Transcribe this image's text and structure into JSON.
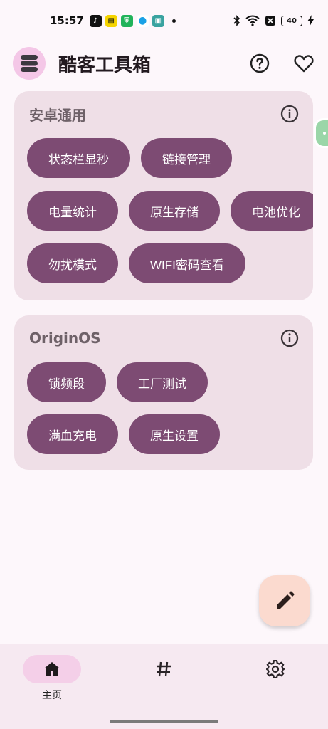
{
  "status_bar": {
    "time": "15:57",
    "battery": "40",
    "icons": [
      "tiktok-icon",
      "app-icon",
      "shield-app-icon",
      "qq-icon",
      "game-app-icon",
      "bluetooth-icon",
      "wifi-icon",
      "data-off-icon",
      "charging-icon"
    ]
  },
  "app": {
    "title": "酷客工具箱",
    "actions": [
      "help-icon",
      "favorite-icon"
    ]
  },
  "cards": [
    {
      "title": "安卓通用",
      "rows": [
        [
          "状态栏显秒",
          "链接管理"
        ],
        [
          "电量统计",
          "原生存储",
          "电池优化"
        ],
        [
          "勿扰模式",
          "WIFI密码查看"
        ]
      ]
    },
    {
      "title": "OriginOS",
      "rows": [
        [
          "锁频段",
          "工厂测试"
        ],
        [
          "满血充电",
          "原生设置"
        ]
      ]
    }
  ],
  "fab": {
    "icon": "edit-icon"
  },
  "bottom_nav": {
    "items": [
      {
        "label": "主页",
        "icon": "home-icon",
        "active": true
      },
      {
        "label": "",
        "icon": "hash-icon",
        "active": false
      },
      {
        "label": "",
        "icon": "settings-icon",
        "active": false
      }
    ]
  },
  "colors": {
    "chip": "#7d4b73",
    "card": "#efdfe7",
    "fab": "#fbdacf",
    "nav_active": "#f4cfe8"
  }
}
